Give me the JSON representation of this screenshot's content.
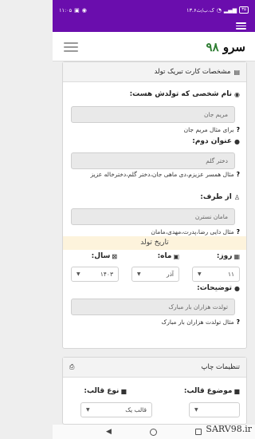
{
  "status_bar": {
    "time": "۱۱:۰۵",
    "speed": "۱۳.۶ک.ب/ث",
    "battery": "۳۵",
    "icons": [
      "signal-icon",
      "wifi-icon",
      "notification-icon"
    ]
  },
  "header": {
    "logo_text": "سرو",
    "logo_number": "۹۸"
  },
  "card_specs": {
    "title": "مشخصات کارت تبریک تولد",
    "name_label": "نام شخصی که تولدش هست:",
    "name_placeholder": "مریم جان",
    "name_hint": "برای مثال مریم جان",
    "title2_label": "عنوان دوم:",
    "title2_placeholder": "دختر گلم",
    "title2_hint": "مثال همسر عزیزم،دی ماهی جان،دختر گلم،دخترخاله عزیز",
    "from_label": "از طرف:",
    "from_placeholder": "مامان نسترن",
    "from_hint": "مثال دایی رضا،پدرت،مهدی،مامان",
    "date_heading": "تاریخ تولد",
    "day_label": "روز:",
    "month_label": "ماه:",
    "year_label": "سال:",
    "day_value": "۱۱",
    "month_value": "آذر",
    "year_value": "۱۴۰۳",
    "desc_label": "توضیحات:",
    "desc_placeholder": "تولدت هزاران بار مبارک",
    "desc_hint": "مثال تولدت هزاران بار مبارک",
    "hint_mark": "?"
  },
  "card_print": {
    "title": "تنظیمات چاپ",
    "subject_label": "موضوع قالب:",
    "type_label": "نوع قالب:",
    "type_value": "قالب یک"
  },
  "watermark": "SARV98.ir"
}
